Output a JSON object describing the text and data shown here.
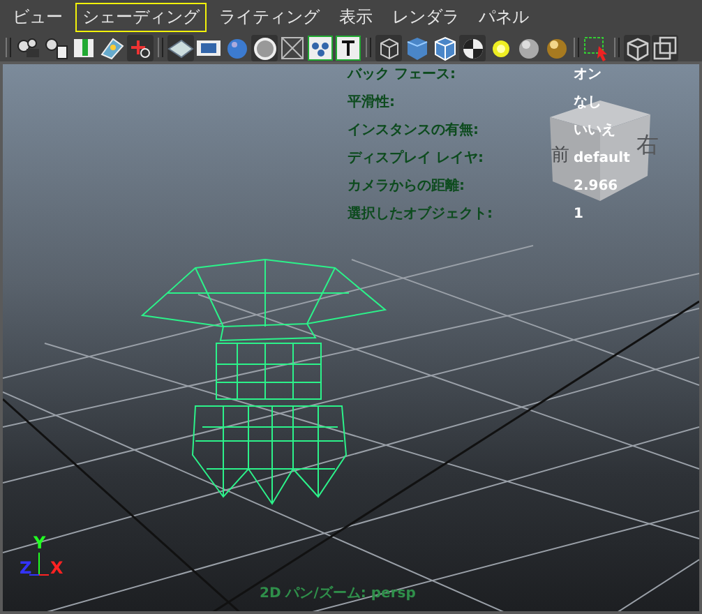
{
  "menu": [
    {
      "label": "ビュー",
      "selected": false
    },
    {
      "label": "シェーディング",
      "selected": true
    },
    {
      "label": "ライティング",
      "selected": false
    },
    {
      "label": "表示",
      "selected": false
    },
    {
      "label": "レンダラ",
      "selected": false
    },
    {
      "label": "パネル",
      "selected": false
    }
  ],
  "hud": [
    {
      "label": "バック フェース:",
      "value": "オン"
    },
    {
      "label": "平滑性:",
      "value": "なし"
    },
    {
      "label": "インスタンスの有無:",
      "value": "いいえ"
    },
    {
      "label": "ディスプレイ レイヤ:",
      "value": "default"
    },
    {
      "label": "カメラからの距離:",
      "value": "2.966"
    },
    {
      "label": "選択したオブジェクト:",
      "value": "1"
    }
  ],
  "view_cube": {
    "front": "前",
    "right": "右"
  },
  "axes": {
    "y": "Y",
    "z": "Z",
    "x": "X"
  },
  "camera_label": "2D パン/ズーム: persp"
}
